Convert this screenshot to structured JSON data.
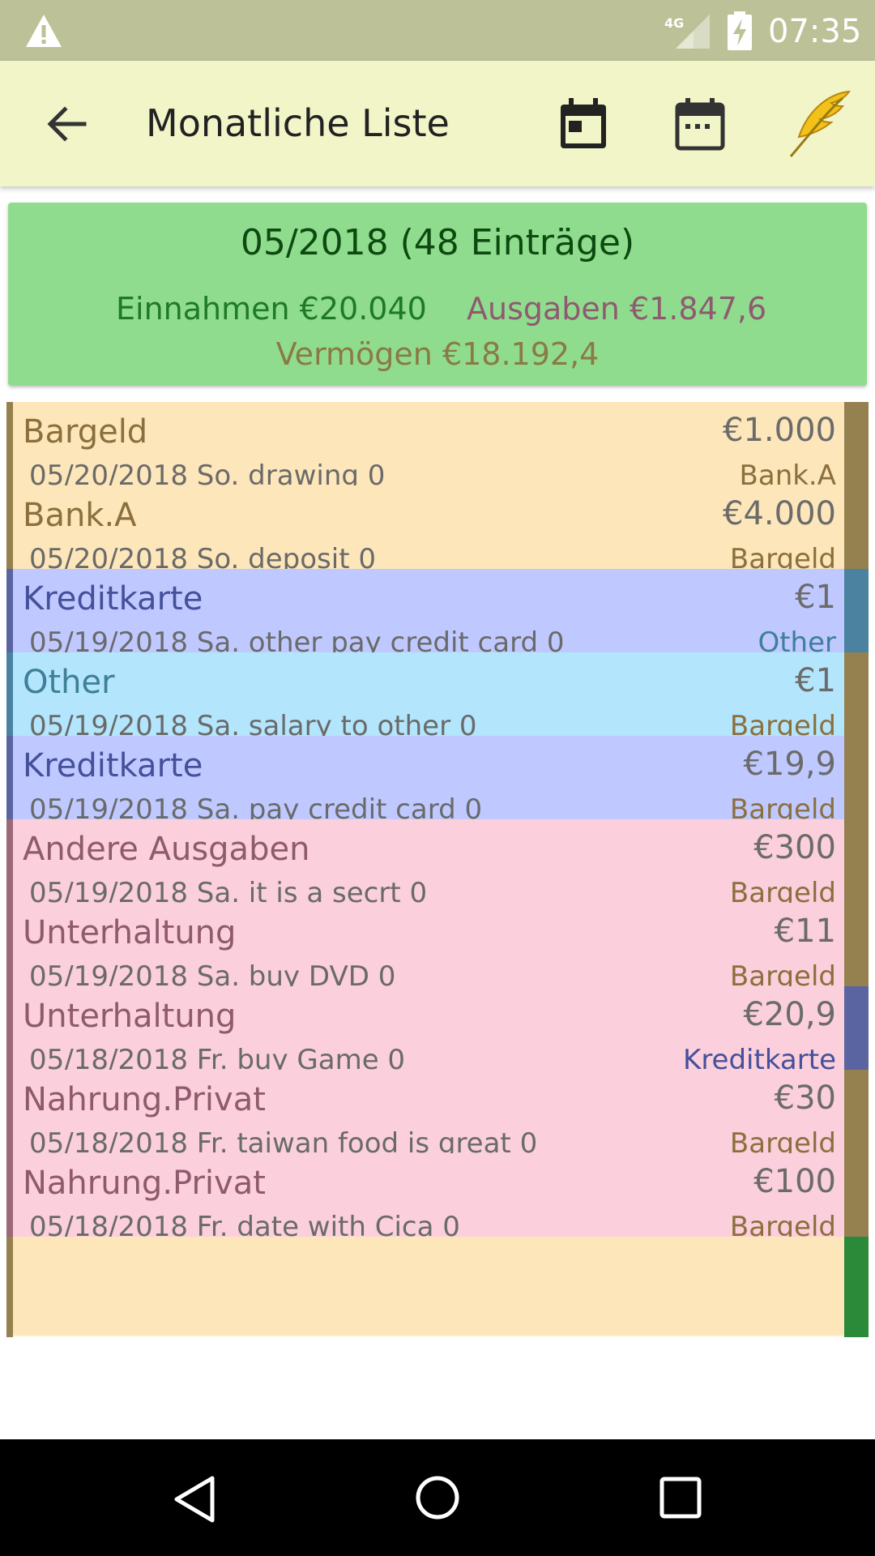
{
  "status_bar": {
    "time": "07:35",
    "network_label": "4G",
    "icons": [
      "warning-icon",
      "signal-icon",
      "battery-charging-icon"
    ]
  },
  "app_bar": {
    "title": "Monatliche Liste",
    "icons": [
      "back-arrow-icon",
      "calendar-day-icon",
      "calendar-month-icon",
      "feather-icon"
    ]
  },
  "summary": {
    "month_title": "05/2018 (48 Einträge)",
    "income": "Einnahmen €20.040",
    "expense": "Ausgaben €1.847,6",
    "assets": "Vermögen €18.192,4"
  },
  "colors": {
    "status_bar": "#bdc197",
    "app_bar": "#f2f5c8",
    "summary_bg": "#90dc8e",
    "transfer_row": "#fde6b9",
    "credit_row": "#bfc9ff",
    "other_row": "#b3e5fc",
    "expense_row": "#fbcfdc",
    "account_bargeld": "#95804f",
    "account_other": "#4a82a0",
    "account_kreditkarte": "#5a64a0"
  },
  "entries": [
    {
      "category": "Bargeld",
      "amount": "€1.000",
      "description": "05/20/2018 So. drawing  0",
      "account": "Bank.A",
      "row_color": "#fde6b9",
      "left_color": "#95804f",
      "right_color": "#95804f",
      "cat_color": "#8b6f3d",
      "acct_color": "#8b6f3d"
    },
    {
      "category": "Bank.A",
      "amount": "€4.000",
      "description": "05/20/2018 So. deposit  0",
      "account": "Bargeld",
      "row_color": "#fde6b9",
      "left_color": "#95804f",
      "right_color": "#95804f",
      "cat_color": "#8b6f3d",
      "acct_color": "#8b6f3d"
    },
    {
      "category": "Kreditkarte",
      "amount": "€1",
      "description": "05/19/2018 Sa. other pay credit card 0",
      "account": "Other",
      "row_color": "#bfc9ff",
      "left_color": "#5a64a0",
      "right_color": "#4a82a0",
      "cat_color": "#45509a",
      "acct_color": "#3f7f98"
    },
    {
      "category": "Other",
      "amount": "€1",
      "description": "05/19/2018 Sa. salary to other 0",
      "account": "Bargeld",
      "row_color": "#b3e5fc",
      "left_color": "#4a82a0",
      "right_color": "#95804f",
      "cat_color": "#3f7f98",
      "acct_color": "#8b6f3d"
    },
    {
      "category": "Kreditkarte",
      "amount": "€19,9",
      "description": "05/19/2018 Sa. pay credit card 0",
      "account": "Bargeld",
      "row_color": "#bfc9ff",
      "left_color": "#5a64a0",
      "right_color": "#95804f",
      "cat_color": "#45509a",
      "acct_color": "#8b6f3d"
    },
    {
      "category": "Andere Ausgaben",
      "amount": "€300",
      "description": "05/19/2018 Sa. it is a secrt  0",
      "account": "Bargeld",
      "row_color": "#fbcfdc",
      "left_color": "#9a6a78",
      "right_color": "#95804f",
      "cat_color": "#8e5a6c",
      "acct_color": "#8b6f3d"
    },
    {
      "category": "Unterhaltung",
      "amount": "€11",
      "description": "05/19/2018 Sa. buy DVD 0",
      "account": "Bargeld",
      "row_color": "#fbcfdc",
      "left_color": "#9a6a78",
      "right_color": "#95804f",
      "cat_color": "#8e5a6c",
      "acct_color": "#8b6f3d"
    },
    {
      "category": "Unterhaltung",
      "amount": "€20,9",
      "description": "05/18/2018 Fr. buy Game 0",
      "account": "Kreditkarte",
      "row_color": "#fbcfdc",
      "left_color": "#9a6a78",
      "right_color": "#5a64a0",
      "cat_color": "#8e5a6c",
      "acct_color": "#45509a"
    },
    {
      "category": "Nahrung.Privat",
      "amount": "€30",
      "description": "05/18/2018 Fr. taiwan food is great 0",
      "account": "Bargeld",
      "row_color": "#fbcfdc",
      "left_color": "#9a6a78",
      "right_color": "#95804f",
      "cat_color": "#8e5a6c",
      "acct_color": "#8b6f3d"
    },
    {
      "category": "Nahrung.Privat",
      "amount": "€100",
      "description": "05/18/2018 Fr. date with Cica 0",
      "account": "Bargeld",
      "row_color": "#fbcfdc",
      "left_color": "#9a6a78",
      "right_color": "#95804f",
      "cat_color": "#8e5a6c",
      "acct_color": "#8b6f3d"
    },
    {
      "category": "",
      "amount": "",
      "description": "",
      "account": "",
      "row_color": "#fde6b9",
      "left_color": "#95804f",
      "right_color": "#2a8a3a",
      "cat_color": "#8b6f3d",
      "acct_color": "#8b6f3d"
    }
  ],
  "nav_bar": {
    "icons": [
      "nav-back-icon",
      "nav-home-icon",
      "nav-recent-icon"
    ]
  }
}
